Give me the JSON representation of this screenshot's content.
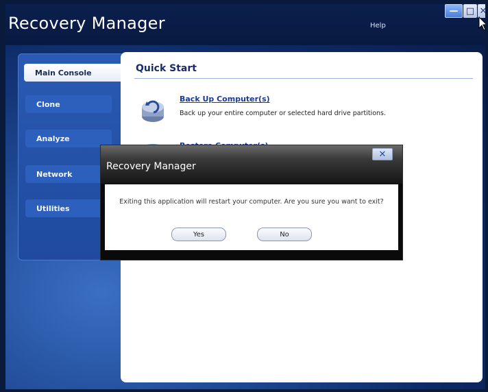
{
  "app": {
    "title": "Recovery Manager",
    "help_label": "Help",
    "window_controls": {
      "minimize": "—",
      "maximize": "□",
      "close": "✕"
    }
  },
  "sidebar": {
    "items": [
      {
        "label": "Main Console",
        "active": true
      },
      {
        "label": "Clone",
        "active": false
      },
      {
        "label": "Analyze",
        "active": false
      },
      {
        "label": "Network",
        "active": false
      },
      {
        "label": "Utilities",
        "active": false
      }
    ]
  },
  "main": {
    "section_title": "Quick Start",
    "actions": [
      {
        "label": "Back Up Computer(s)",
        "description": "Back up your entire computer or selected hard drive partitions.",
        "icon": "backup-icon"
      },
      {
        "label": "Restore Computer(s)",
        "description": "",
        "icon": "restore-icon"
      }
    ]
  },
  "dialog": {
    "title": "Recovery Manager",
    "close_glyph": "✕",
    "message": "Exiting this application will restart your computer. Are you sure you want to exit?",
    "yes_label": "Yes",
    "no_label": "No"
  },
  "colors": {
    "accent": "#1a3a9a",
    "sidebar": "#2a5ab3",
    "background": "#0d2a66"
  }
}
